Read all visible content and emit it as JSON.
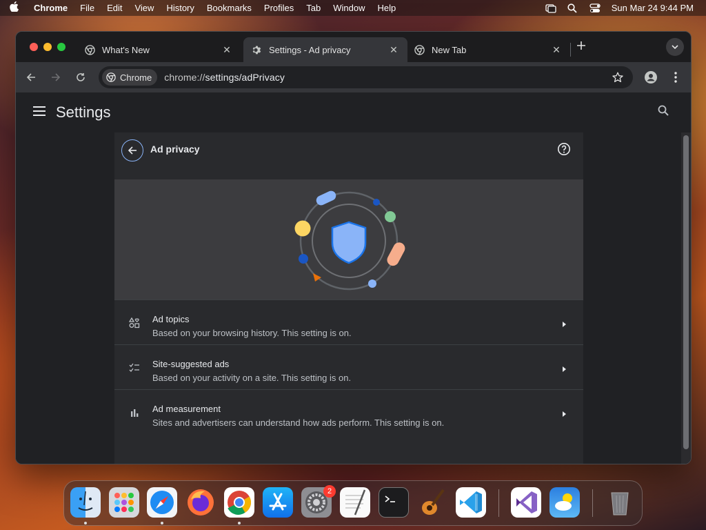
{
  "menubar": {
    "app_name": "Chrome",
    "items": [
      "File",
      "Edit",
      "View",
      "History",
      "Bookmarks",
      "Profiles",
      "Tab",
      "Window",
      "Help"
    ],
    "datetime": "Sun Mar 24  9:44 PM"
  },
  "tabs": [
    {
      "title": "What's New",
      "icon": "chrome-icon",
      "active": false
    },
    {
      "title": "Settings - Ad privacy",
      "icon": "gear-icon",
      "active": true
    },
    {
      "title": "New Tab",
      "icon": "chrome-icon",
      "active": false
    }
  ],
  "tab_close_glyph": "✕",
  "omnibox": {
    "chip_label": "Chrome",
    "url_scheme": "chrome://",
    "url_path": "settings/adPrivacy"
  },
  "settings": {
    "page_title": "Settings",
    "card_title": "Ad privacy",
    "rows": [
      {
        "title": "Ad topics",
        "subtitle": "Based on your browsing history. This setting is on.",
        "icon": "ad-topics-icon"
      },
      {
        "title": "Site-suggested ads",
        "subtitle": "Based on your activity on a site. This setting is on.",
        "icon": "checklist-icon"
      },
      {
        "title": "Ad measurement",
        "subtitle": "Sites and advertisers can understand how ads perform. This setting is on.",
        "icon": "bar-chart-icon"
      }
    ]
  },
  "dock": {
    "apps": [
      "Finder",
      "Launchpad",
      "Safari",
      "Firefox",
      "Chrome",
      "App Store",
      "System Settings",
      "TextEdit",
      "Terminal",
      "GarageBand",
      "Visual Studio Code",
      "Visual Studio",
      "Weather",
      "Trash"
    ],
    "system_settings_badge": "2"
  },
  "colors": {
    "accent": "#8ab4f8",
    "window_bg": "#202124",
    "card_bg": "#292a2d",
    "hero_bg": "#3c3c3f"
  }
}
